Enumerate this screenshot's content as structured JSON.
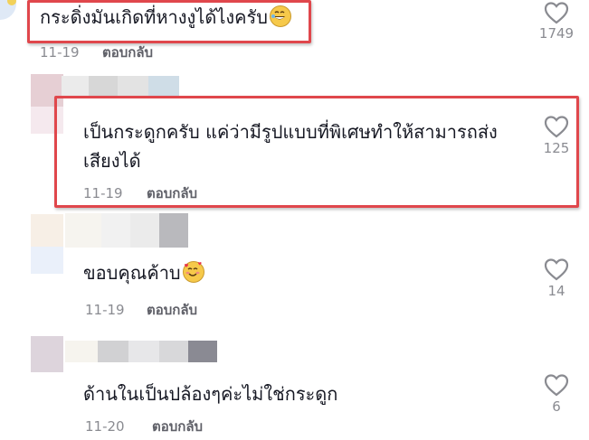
{
  "comments": [
    {
      "text": "กระดิ่งมันเกิดที่หางงูได้ไงครับ",
      "emoji": "grinning-sweat-emoji",
      "date": "11-19",
      "reply_label": "ตอบกลับ",
      "likes": "1749"
    },
    {
      "text_line1": "เป็นกระดูกครับ แค่ว่ามีรูปแบบที่พิเศษทำให้สามารถส่ง",
      "text_line2": "เสียงได้",
      "date": "11-19",
      "reply_label": "ตอบกลับ",
      "likes": "125"
    },
    {
      "text": "ขอบคุณค้าบ",
      "emoji": "smiling-hearts-emoji",
      "date": "11-19",
      "reply_label": "ตอบกลับ",
      "likes": "14"
    },
    {
      "text": "ด้านในเป็นปล้องๆค่ะไม่ใช่กระดูก",
      "date": "11-20",
      "reply_label": "ตอบกลับ",
      "likes": "6"
    }
  ],
  "colors": {
    "highlight": "#e0474c",
    "text": "#161823",
    "meta": "#8a8b91",
    "reply": "#5f6068"
  }
}
